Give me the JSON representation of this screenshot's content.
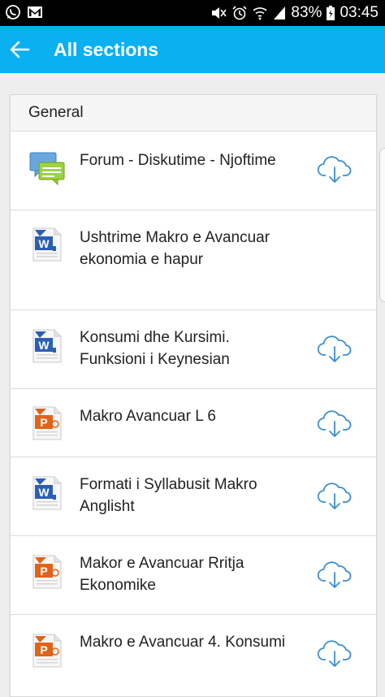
{
  "status": {
    "battery": "83%",
    "time": "03:45"
  },
  "app_bar": {
    "title": "All sections"
  },
  "section": {
    "header": "General"
  },
  "items": [
    {
      "label": "Forum - Diskutime - Njoftime",
      "icon": "forum-icon",
      "download": true
    },
    {
      "label": "Ushtrime Makro e Avancuar ekonomia e hapur",
      "icon": "word-document-icon",
      "download": false
    },
    {
      "label": "Konsumi dhe Kursimi. Funksioni i Keynesian",
      "icon": "word-document-icon",
      "download": true
    },
    {
      "label": "Makro Avancuar L 6",
      "icon": "powerpoint-document-icon",
      "download": true
    },
    {
      "label": "Formati i Syllabusit Makro Anglisht",
      "icon": "word-document-icon",
      "download": true
    },
    {
      "label": "Makor e Avancuar Rritja Ekonomike",
      "icon": "powerpoint-document-icon",
      "download": true
    },
    {
      "label": "Makro e Avancuar 4. Konsumi",
      "icon": "powerpoint-document-icon",
      "download": true
    }
  ],
  "colors": {
    "app_bar": "#0ab0f0",
    "download_icon": "#3a8fd0",
    "word": "#2b5fb4",
    "powerpoint": "#e0631a"
  }
}
